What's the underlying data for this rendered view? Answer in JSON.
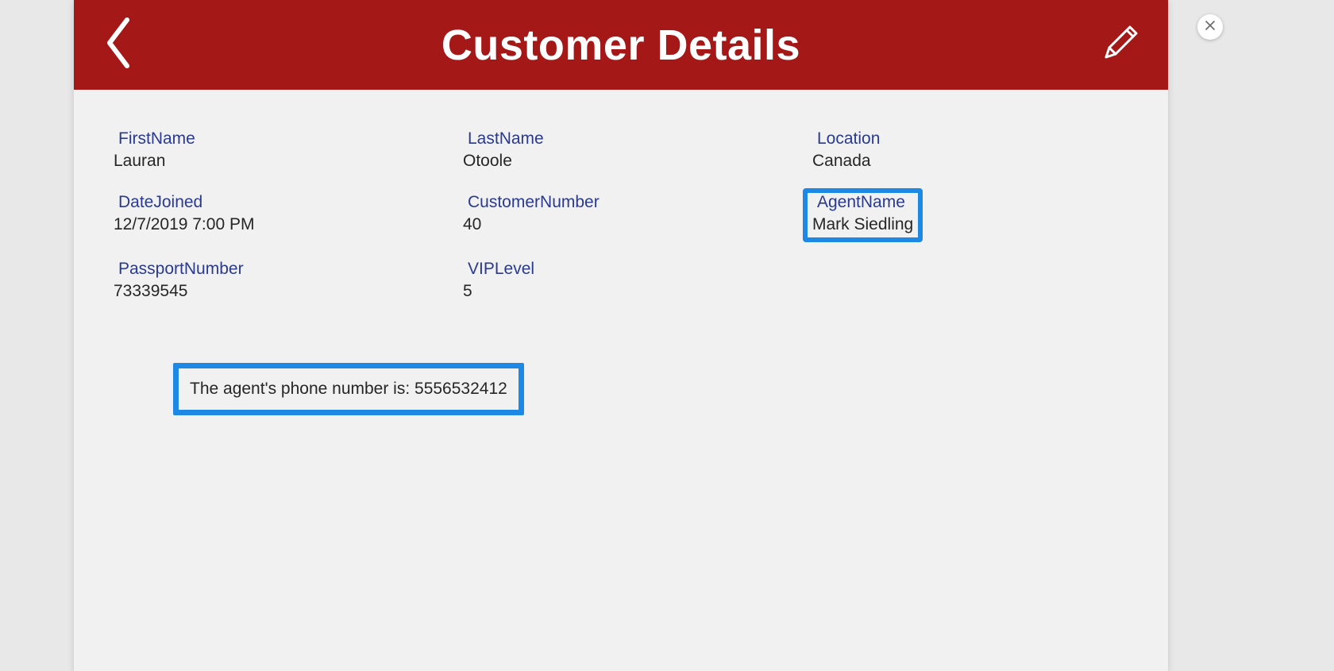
{
  "header": {
    "title": "Customer Details"
  },
  "fields": {
    "firstName": {
      "label": "FirstName",
      "value": "Lauran"
    },
    "lastName": {
      "label": "LastName",
      "value": "Otoole"
    },
    "location": {
      "label": "Location",
      "value": "Canada"
    },
    "dateJoined": {
      "label": "DateJoined",
      "value": "12/7/2019 7:00 PM"
    },
    "customerNumber": {
      "label": "CustomerNumber",
      "value": "40"
    },
    "agentName": {
      "label": "AgentName",
      "value": "Mark Siedling"
    },
    "passportNumber": {
      "label": "PassportNumber",
      "value": "73339545"
    },
    "vipLevel": {
      "label": "VIPLevel",
      "value": "5"
    }
  },
  "note": {
    "text": "The agent's phone number is: 5556532412"
  },
  "highlight": {
    "field": "agentName",
    "color": "#1e88e5"
  }
}
